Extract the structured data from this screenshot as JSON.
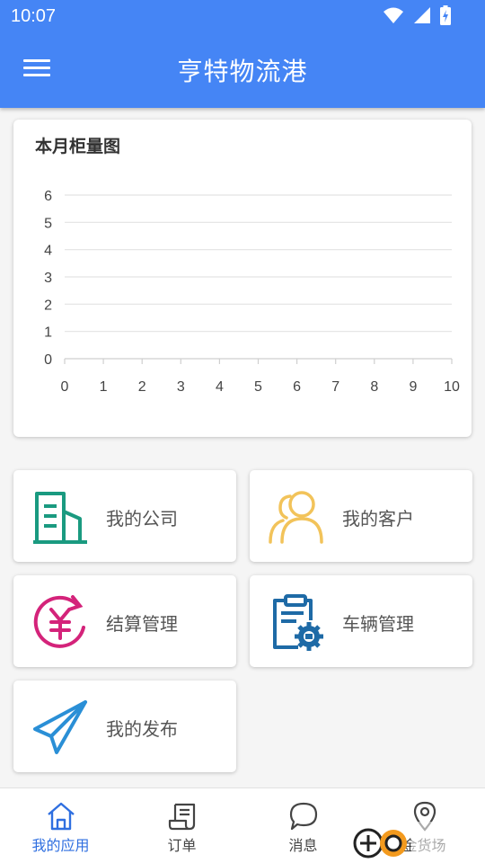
{
  "status_bar": {
    "time": "10:07"
  },
  "app_bar": {
    "title": "亨特物流港",
    "menu_icon": "hamburger-menu-icon"
  },
  "chart_card": {
    "title": "本月柜量图"
  },
  "chart_data": {
    "type": "line",
    "title": "本月柜量图",
    "xlabel": "",
    "ylabel": "",
    "x_ticks": [
      0,
      1,
      2,
      3,
      4,
      5,
      6,
      7,
      8,
      9,
      10
    ],
    "y_ticks": [
      0,
      1,
      2,
      3,
      4,
      5,
      6
    ],
    "xlim": [
      0,
      10
    ],
    "ylim": [
      0,
      6
    ],
    "grid": true,
    "series": []
  },
  "tiles": [
    {
      "label": "我的公司",
      "icon": "building-icon",
      "color": "#1a9a80"
    },
    {
      "label": "我的客户",
      "icon": "users-icon",
      "color": "#f2c35a"
    },
    {
      "label": "结算管理",
      "icon": "yuan-cycle-icon",
      "color": "#d4237a"
    },
    {
      "label": "车辆管理",
      "icon": "clipboard-gear-icon",
      "color": "#1e6aa6"
    },
    {
      "label": "我的发布",
      "icon": "paper-plane-icon",
      "color": "#2a8fd6"
    }
  ],
  "bottom_nav": [
    {
      "label": "我的应用",
      "icon": "home-icon",
      "active": true
    },
    {
      "label": "订单",
      "icon": "receipt-icon",
      "active": false
    },
    {
      "label": "消息",
      "icon": "chat-bubble-icon",
      "active": false
    },
    {
      "label": "金货场",
      "icon": "location-pin-icon",
      "active": false
    }
  ],
  "colors": {
    "primary": "#4585f5",
    "active_nav": "#2f6fe0"
  }
}
